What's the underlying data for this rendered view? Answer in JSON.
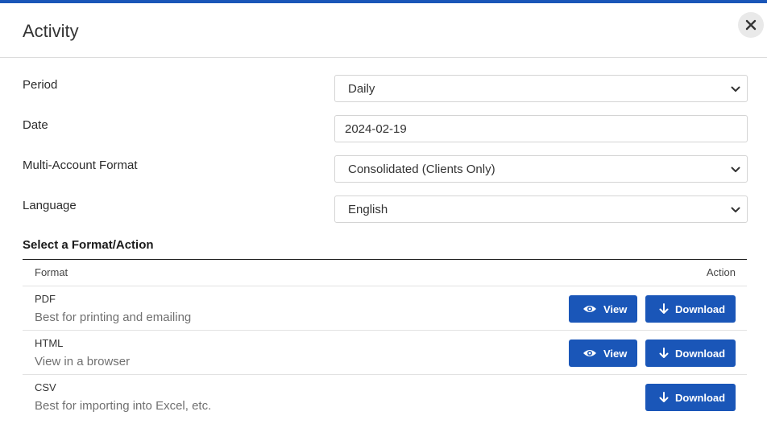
{
  "dialog": {
    "title": "Activity",
    "close_icon": "close-icon"
  },
  "form": {
    "period": {
      "label": "Period",
      "value": "Daily"
    },
    "date": {
      "label": "Date",
      "value": "2024-02-19"
    },
    "multi_account": {
      "label": "Multi-Account Format",
      "value": "Consolidated (Clients Only)"
    },
    "language": {
      "label": "Language",
      "value": "English"
    }
  },
  "section": {
    "title": "Select a Format/Action",
    "col_format": "Format",
    "col_action": "Action"
  },
  "formats": [
    {
      "name": "PDF",
      "description": "Best for printing and emailing",
      "view_label": "View",
      "download_label": "Download"
    },
    {
      "name": "HTML",
      "description": "View in a browser",
      "view_label": "View",
      "download_label": "Download"
    },
    {
      "name": "CSV",
      "description": "Best for importing into Excel, etc.",
      "download_label": "Download"
    }
  ],
  "colors": {
    "accent": "#1a56b8"
  }
}
